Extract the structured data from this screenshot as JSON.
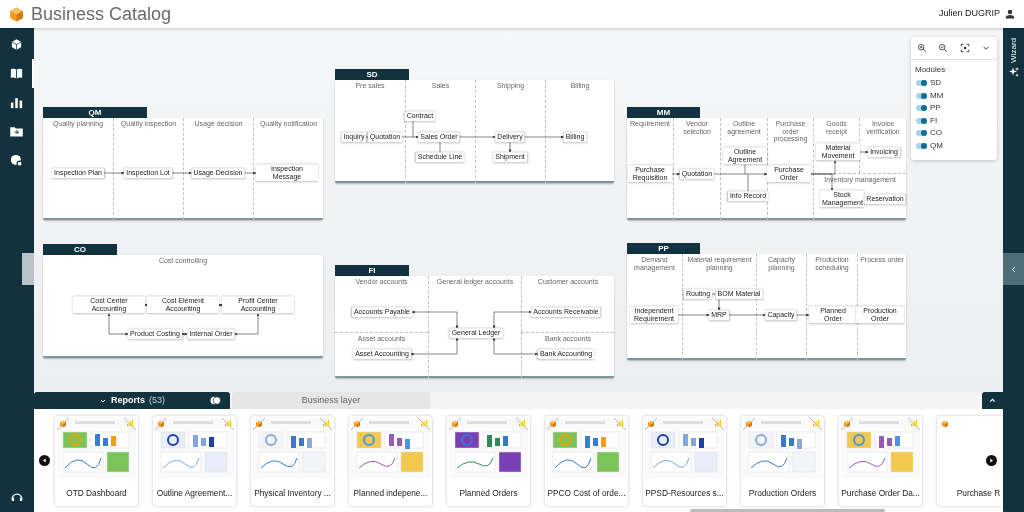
{
  "app": {
    "title": "Business Catalog",
    "user": "Julien DUGRIP"
  },
  "sidebar": {
    "items": [
      {
        "selected": false
      },
      {
        "selected": true
      },
      {
        "selected": false
      },
      {
        "selected": false
      },
      {
        "selected": false
      }
    ]
  },
  "wizard": {
    "label": "Wizard"
  },
  "modules": [
    {
      "title": "SD",
      "lanes": [
        "Pre sales",
        "Sales",
        "Shipping",
        "Billing"
      ],
      "nodes": [
        "Inquiry",
        "Quotation",
        "Contract",
        "Sales Order",
        "Schedule Line",
        "Delivery",
        "Shipment",
        "Billing"
      ]
    },
    {
      "title": "QM",
      "lanes": [
        "Quality planning",
        "Quality inspection",
        "Usage decision",
        "Quality notification"
      ],
      "nodes": [
        "Inspection Plan",
        "Inspection Lot",
        "Usage Decision",
        "Inspection Message"
      ]
    },
    {
      "title": "MM",
      "lanes": [
        "Requirement",
        "Vendor selection",
        "Outline agreement",
        "Purchase order processing",
        "Goods receipt",
        "Invoice verification",
        "Inventory management"
      ],
      "nodes": [
        "Purchase Requisition",
        "Quotation",
        "Outline Agreement",
        "Info Record",
        "Purchase Order",
        "Material Movement",
        "Invoicing",
        "Stock Management",
        "Reservation"
      ]
    },
    {
      "title": "CO",
      "lanes": [
        "Cost controlling"
      ],
      "nodes": [
        "Cost Center Accounting",
        "Cost Element Accounting",
        "Profit Center Accounting",
        "Product Costing",
        "Internal Order"
      ]
    },
    {
      "title": "PP",
      "lanes": [
        "Demand management",
        "Material requirement planning",
        "Capacity planning",
        "Production scheduling",
        "Process order"
      ],
      "nodes": [
        "Routing",
        "BOM Material",
        "Independent Requirement",
        "MRP",
        "Capacity",
        "Planned Order",
        "Production Order"
      ]
    },
    {
      "title": "FI",
      "lanes": [
        "Vendor accounts",
        "General ledger accounts",
        "Customer accounts",
        "Asset accounts",
        "Bank accounts"
      ],
      "nodes": [
        "Accounts Payable",
        "General Ledger",
        "Accounts Receivable",
        "Asset Accounting",
        "Bank Accounting"
      ]
    }
  ],
  "module_filter": {
    "title": "Modules",
    "items": [
      {
        "label": "SD",
        "on": true
      },
      {
        "label": "MM",
        "on": true
      },
      {
        "label": "PP",
        "on": true
      },
      {
        "label": "FI",
        "on": true
      },
      {
        "label": "CO",
        "on": true
      },
      {
        "label": "QM",
        "on": true
      }
    ]
  },
  "bottom_panel": {
    "tabs": [
      {
        "label": "Reports",
        "count": "(53)",
        "selected": true
      },
      {
        "label": "Business layer",
        "selected": false
      }
    ],
    "reports": [
      {
        "title": "OTD Dashboard"
      },
      {
        "title": "Outline Agreement..."
      },
      {
        "title": "Physical Inventory ..."
      },
      {
        "title": "Planned indepene..."
      },
      {
        "title": "Planned Orders"
      },
      {
        "title": "PPCO Cost of orde..."
      },
      {
        "title": "PPSD-Resources s..."
      },
      {
        "title": "Production Orders"
      },
      {
        "title": "Purchase Order Da..."
      },
      {
        "title": "Purchase R"
      }
    ]
  }
}
